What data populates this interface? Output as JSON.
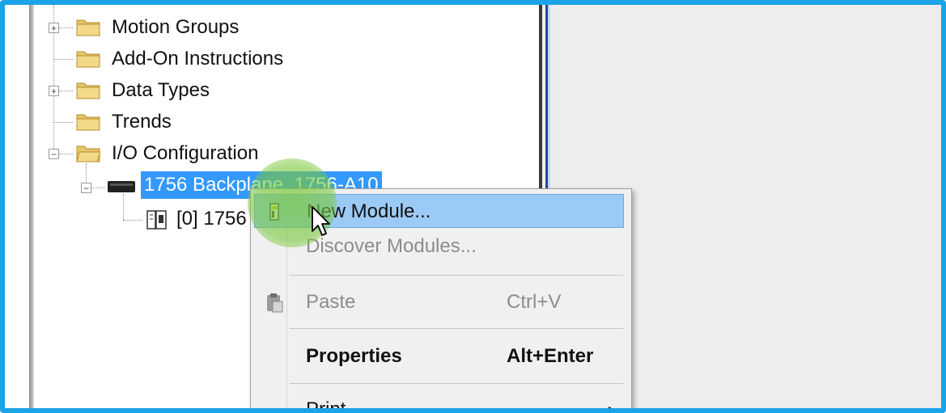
{
  "colors": {
    "frame": "#1aa3e6",
    "selection": "#3399ff",
    "menu_highlight": "#9ccaf6",
    "folder": "#e8c46a",
    "highlight_halo": "#78c83c"
  },
  "tree": {
    "items": [
      {
        "label": "Motion Groups",
        "icon": "folder-icon",
        "expandable": true
      },
      {
        "label": "Add-On Instructions",
        "icon": "folder-icon",
        "expandable": false
      },
      {
        "label": "Data Types",
        "icon": "folder-icon",
        "expandable": true
      },
      {
        "label": "Trends",
        "icon": "folder-icon",
        "expandable": false
      },
      {
        "label": "I/O Configuration",
        "icon": "open-folder-icon",
        "expandable": true,
        "expanded": true
      },
      {
        "label": "1756 Backplane, 1756-A10",
        "icon": "backplane-icon",
        "expandable": true,
        "expanded": true,
        "selected": true
      },
      {
        "label": "[0] 1756",
        "icon": "controller-module-icon",
        "expandable": false
      }
    ]
  },
  "context_menu": {
    "items": [
      {
        "label": "New Module...",
        "shortcut": "",
        "icon": "new-module-icon",
        "highlighted": true,
        "enabled": true
      },
      {
        "label": "Discover Modules...",
        "shortcut": "",
        "icon": "",
        "enabled": false
      },
      {
        "label": "Paste",
        "shortcut": "Ctrl+V",
        "icon": "paste-icon",
        "enabled": false
      },
      {
        "label": "Properties",
        "shortcut": "Alt+Enter",
        "icon": "",
        "enabled": true,
        "bold": true
      },
      {
        "label": "Print",
        "shortcut": "",
        "icon": "",
        "enabled": true,
        "submenu": true
      }
    ],
    "submenu_arrow": "▶"
  }
}
